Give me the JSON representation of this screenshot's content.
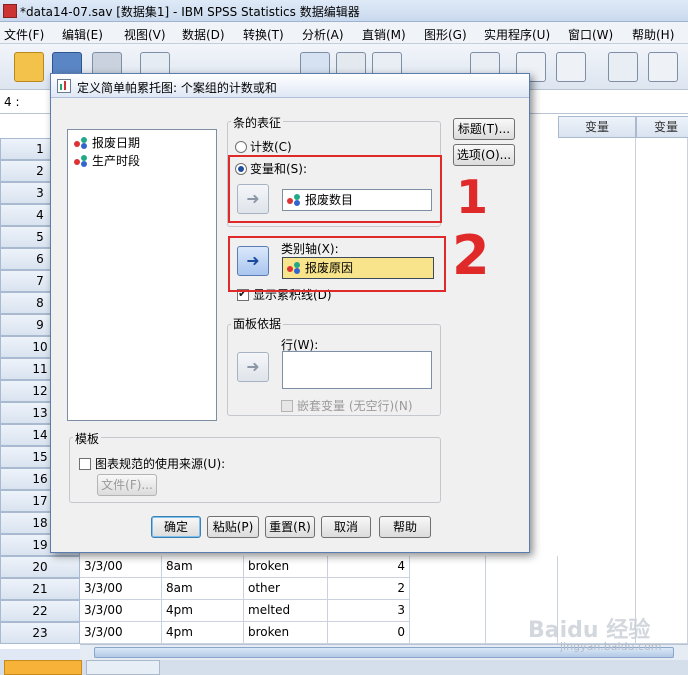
{
  "window": {
    "title": "*data14-07.sav [数据集1] - IBM SPSS Statistics 数据编辑器"
  },
  "menu": [
    "文件(F)",
    "编辑(E)",
    "视图(V)",
    "数据(D)",
    "转换(T)",
    "分析(A)",
    "直销(M)",
    "图形(G)",
    "实用程序(U)",
    "窗口(W)",
    "帮助(H)"
  ],
  "cell_ref": "4 :",
  "grid": {
    "col_headers": [
      "变量",
      "变量"
    ],
    "row_numbers": [
      "1",
      "2",
      "3",
      "4",
      "5",
      "6",
      "7",
      "8",
      "9",
      "10",
      "11",
      "12",
      "13",
      "14",
      "15",
      "16",
      "17",
      "18",
      "19",
      "20",
      "21",
      "22",
      "23"
    ],
    "visible_rows": [
      {
        "row": "20",
        "date": "3/3/00",
        "time": "8am",
        "reason": "broken",
        "count": "4"
      },
      {
        "row": "21",
        "date": "3/3/00",
        "time": "8am",
        "reason": "other",
        "count": "2"
      },
      {
        "row": "22",
        "date": "3/3/00",
        "time": "4pm",
        "reason": "melted",
        "count": "3"
      },
      {
        "row": "23",
        "date": "3/3/00",
        "time": "4pm",
        "reason": "broken",
        "count": "0"
      }
    ]
  },
  "dialog": {
    "title": "定义简单帕累托图: 个案组的计数或和",
    "variables": [
      "报废日期",
      "生产时段"
    ],
    "bars_represent": {
      "group_label": "条的表征",
      "count_label": "计数(C)",
      "sum_label": "变量和(S):",
      "selected": "sum",
      "sum_variable": "报废数目"
    },
    "category_axis": {
      "label": "类别轴(X):",
      "value": "报废原因"
    },
    "cumulative_line": {
      "label": "显示累积线(D)",
      "checked": true
    },
    "panel": {
      "group_label": "面板依据",
      "rows_label": "行(W):",
      "nest_label": "嵌套变量 (无空行)(N)"
    },
    "template": {
      "group_label": "模板",
      "use_spec_label": "图表规范的使用来源(U):",
      "file_button": "文件(F)..."
    },
    "side_buttons": [
      "标题(T)...",
      "选项(O)..."
    ],
    "bottom_buttons": [
      "确定",
      "粘贴(P)",
      "重置(R)",
      "取消",
      "帮助"
    ]
  },
  "annotations": [
    "1",
    "2"
  ],
  "watermark": {
    "brand": "Baidu 经验",
    "url": "jingyan.baidu.com"
  },
  "colors": {
    "highlight_field": "#f8e48a",
    "annotation": "#e02a2a",
    "sheet_tab": "#f7b23a"
  }
}
